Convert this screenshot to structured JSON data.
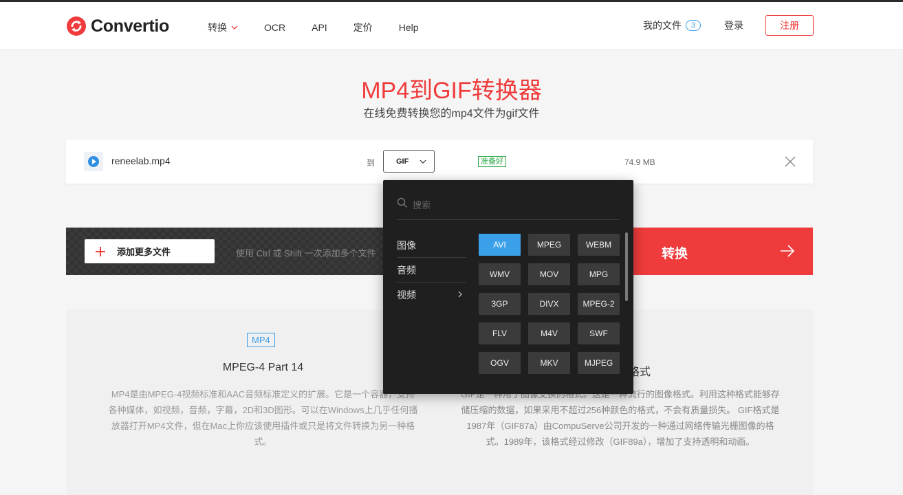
{
  "header": {
    "logo_text": "Convertio",
    "nav": [
      {
        "label": "转换"
      },
      {
        "label": "OCR"
      },
      {
        "label": "API"
      },
      {
        "label": "定价"
      },
      {
        "label": "Help"
      }
    ],
    "my_files_label": "我的文件",
    "my_files_count": "3",
    "login_label": "登录",
    "signup_label": "注册"
  },
  "hero": {
    "title": "MP4到GIF转换器",
    "subtitle": "在线免费转换您的mp4文件为gif文件"
  },
  "file": {
    "name": "reneelab.mp4",
    "to_label": "到",
    "target_format": "GIF",
    "status": "准备好",
    "size": "74.9 MB"
  },
  "actionbar": {
    "add_label": "添加更多文件",
    "hint": "使用 Ctrl 或 Shift 一次添加多个文件",
    "convert_label": "转换"
  },
  "dropdown": {
    "search_placeholder": "搜索",
    "categories": [
      {
        "label": "图像"
      },
      {
        "label": "音频"
      },
      {
        "label": "视频"
      }
    ],
    "formats": [
      "AVI",
      "MPEG",
      "WEBM",
      "WMV",
      "MOV",
      "MPG",
      "3GP",
      "DIVX",
      "MPEG-2",
      "FLV",
      "M4V",
      "SWF",
      "OGV",
      "MKV",
      "MJPEG"
    ],
    "selected_format": "AVI"
  },
  "info": {
    "left_tag": "MP4",
    "left_name": "MPEG-4 Part 14",
    "left_desc": "MP4是由MPEG-4视频标准和AAC音频标准定义的扩展。它是一个容器，支持各种媒体，如视频，音频，字幕，2D和3D图形。可以在Windows上几乎任何播放器打开MP4文件，但在Mac上你应该使用插件或只是将文件转换为另一种格式。",
    "right_name_fragment": "格式",
    "right_desc": "GIF是一种用于图像交换的格式。这是一种流行的图像格式。利用这种格式能够存储压缩的数据，如果采用不超过256种颜色的格式，不会有质量损失。 GIF格式是1987年（GIF87a）由CompuServe公司开发的一种通过网络传输光栅图像的格式。1989年，该格式经过修改（GIF89a），增加了支持透明和动画。"
  },
  "colors": {
    "brand_red": "#ef3b3b",
    "accent_blue": "#3aa0e8",
    "ready_green": "#27a745",
    "dropdown_bg": "#1f1f1f"
  }
}
